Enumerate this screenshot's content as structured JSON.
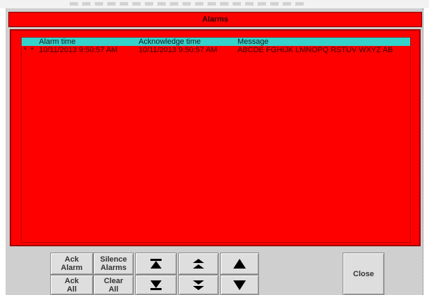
{
  "window": {
    "title": "Alarms"
  },
  "alarm_list": {
    "columns": [
      "Alarm time",
      "Acknowledge time",
      "Message"
    ],
    "rows": [
      {
        "marker1": "*",
        "marker2": "*",
        "alarm_time": "10/11/2013 9:50:57 AM",
        "ack_time": "10/11/2013 9:50:57 AM",
        "message": "ABCDE FGHIJK LMNOPQ RSTUV WXYZ AB"
      }
    ]
  },
  "buttons": {
    "ack_alarm": "Ack\nAlarm",
    "silence_alarms": "Silence\nAlarms",
    "ack_all": "Ack\nAll",
    "clear_all": "Clear\nAll",
    "close": "Close"
  },
  "icons": [
    "scroll-top-icon",
    "page-up-icon",
    "line-up-icon",
    "scroll-bottom-icon",
    "page-down-icon",
    "line-down-icon"
  ],
  "colors": {
    "alarm_background": "#ff0000",
    "header_background": "#35d2cc",
    "panel": "#cfcfcf"
  }
}
